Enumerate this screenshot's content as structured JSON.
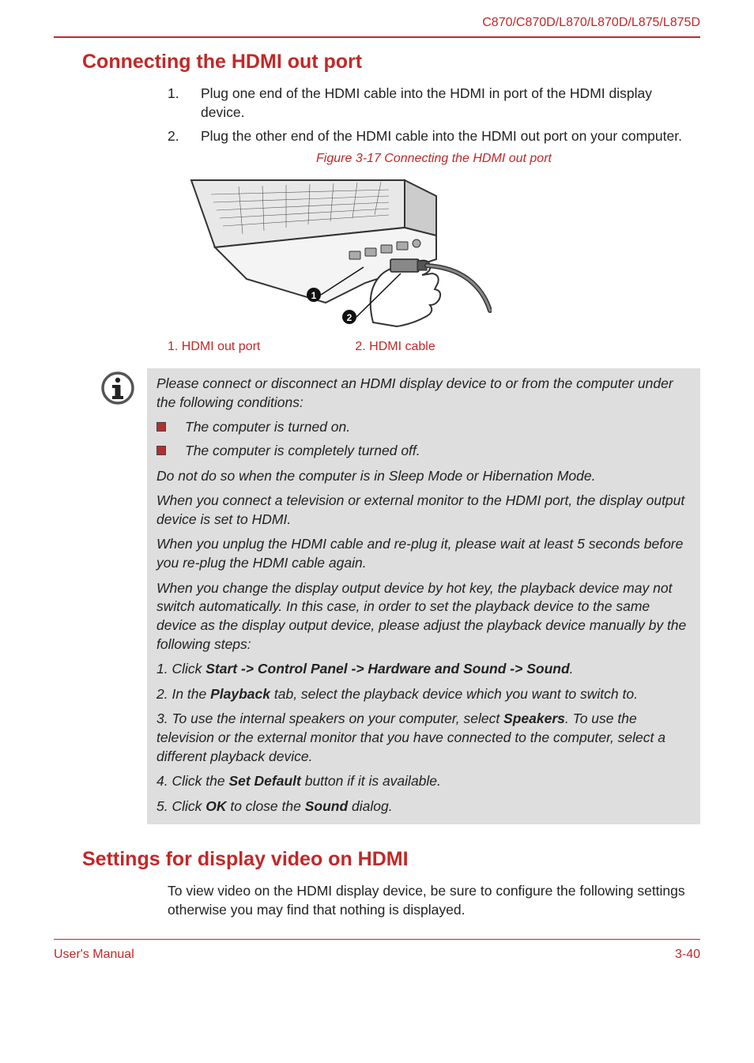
{
  "header": {
    "model": "C870/C870D/L870/L870D/L875/L875D"
  },
  "sections": {
    "connecting": {
      "title": "Connecting the HDMI out port",
      "steps": [
        {
          "num": "1.",
          "text": "Plug one end of the HDMI cable into the HDMI in port of the HDMI display device."
        },
        {
          "num": "2.",
          "text": "Plug the other end of the HDMI cable into the HDMI out port on your computer."
        }
      ],
      "figure_caption": "Figure 3-17 Connecting the HDMI out port",
      "key": [
        "1. HDMI out port",
        "2. HDMI cable"
      ]
    },
    "info": {
      "intro": "Please connect or disconnect an HDMI display device to or from the computer under the following conditions:",
      "bullets": [
        "The computer is turned on.",
        "The computer is completely turned off."
      ],
      "p1": "Do not do so when the computer is in Sleep Mode or Hibernation Mode.",
      "p2": "When you connect a television or external monitor to the HDMI port, the display output device is set to HDMI.",
      "p3": "When you unplug the HDMI cable and re-plug it, please wait at least 5 seconds before you re-plug the HDMI cable again.",
      "p4": "When you change the display output device by hot key, the playback device may not switch automatically. In this case, in order to set the playback device to the same device as the display output device, please adjust the playback device manually by the following steps:",
      "step1_pre": "1. Click ",
      "step1_bold": "Start -> Control Panel -> Hardware and Sound -> Sound",
      "step1_post": ".",
      "step2_pre": "2. In the ",
      "step2_bold": "Playback",
      "step2_post": " tab, select the playback device which you want to switch to.",
      "step3_pre": "3. To use the internal speakers on your computer, select ",
      "step3_bold": "Speakers",
      "step3_post": ". To use the television or the external monitor that you have connected to the computer, select a different playback device.",
      "step4_pre": "4. Click the ",
      "step4_bold": "Set Default",
      "step4_post": " button if it is available.",
      "step5_pre": "5. Click ",
      "step5_bold1": "OK",
      "step5_mid": " to close the ",
      "step5_bold2": "Sound",
      "step5_post": " dialog."
    },
    "settings": {
      "title": "Settings for display video on HDMI",
      "body": "To view video on the HDMI display device, be sure to configure the following settings otherwise you may find that nothing is displayed."
    }
  },
  "footer": {
    "left": "User's Manual",
    "right": "3-40"
  }
}
